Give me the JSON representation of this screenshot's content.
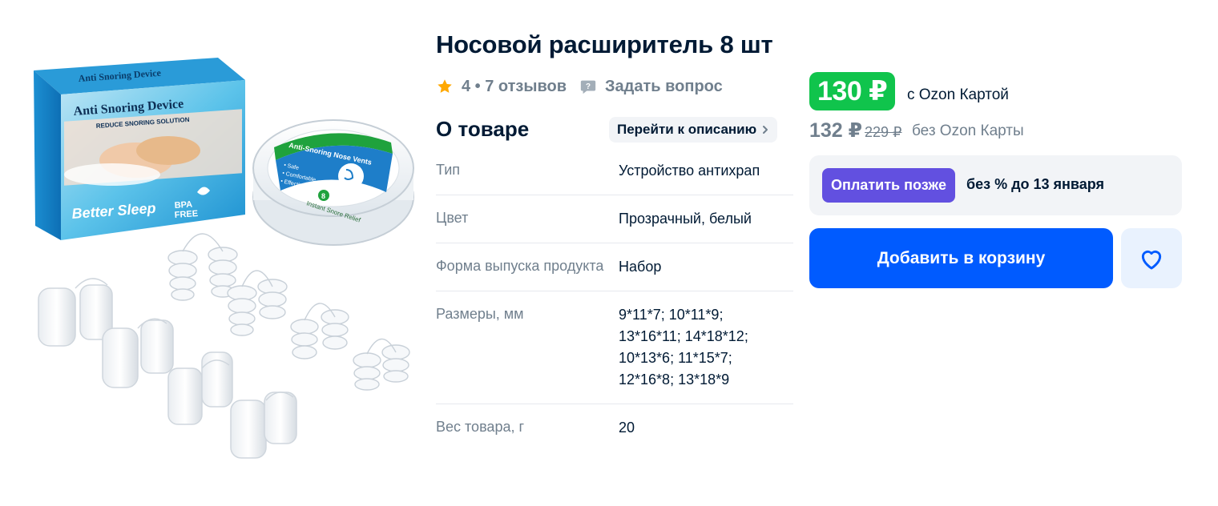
{
  "product": {
    "title": "Носовой расширитель 8 шт",
    "image_alt": "Anti Snoring Device — набор носовых расширителей",
    "image_texts": {
      "box_top": "Anti Snoring Device",
      "box_title": "Anti Snoring Device",
      "box_subtitle": "REDUCE SNORING SOLUTION",
      "box_better": "Better Sleep",
      "box_bpa": "BPA",
      "box_free": "FREE",
      "case_label": "Anti-Snoring Nose Vents",
      "case_safe": "• Safe",
      "case_comfort": "• Comfortable",
      "case_effective": "• Effective",
      "case_relief": "Instant Snore Relief",
      "case_count": "8"
    }
  },
  "rating": {
    "text": "4 • 7 отзывов",
    "star_color": "#f91155",
    "ask_label": "Задать вопрос"
  },
  "about": {
    "heading": "О товаре",
    "link_label": "Перейти к описанию",
    "specs": [
      {
        "key": "Тип",
        "value": [
          "Устройство антихрап"
        ]
      },
      {
        "key": "Цвет",
        "value": [
          "Прозрачный, белый"
        ]
      },
      {
        "key": "Форма выпуска продукта",
        "value": [
          "Набор"
        ]
      },
      {
        "key": "Размеры, мм",
        "value": [
          "9*11*7;  10*11*9;",
          "13*16*11;  14*18*12;",
          "10*13*6;  11*15*7;",
          "12*16*8;  13*18*9"
        ]
      },
      {
        "key": "Вес товара, г",
        "value": [
          "20"
        ]
      }
    ]
  },
  "pricing": {
    "ozon_price": "130 ₽",
    "ozon_card_label": "с Ozon Картой",
    "regular_price": "132 ₽",
    "old_price": "229 ₽",
    "no_card_label": "без Ozon Карты",
    "ozon_color": "#10c44c"
  },
  "pay_later": {
    "button_label": "Оплатить позже",
    "text": "без % до 13 января",
    "color": "#6250e0"
  },
  "actions": {
    "cart_label": "Добавить в корзину",
    "cart_color": "#005bff",
    "favorite_icon": "heart-icon"
  }
}
